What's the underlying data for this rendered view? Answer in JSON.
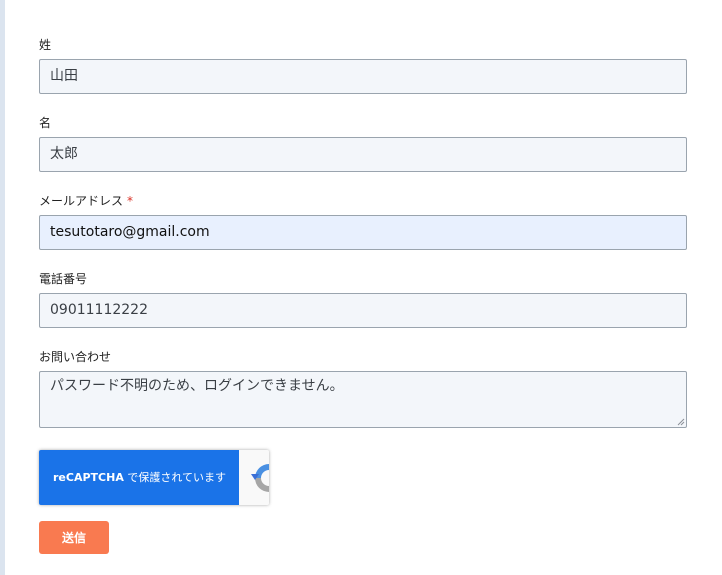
{
  "form": {
    "last_name": {
      "label": "姓",
      "value": "山田"
    },
    "first_name": {
      "label": "名",
      "value": "太郎"
    },
    "email": {
      "label": "メールアドレス",
      "required_mark": "*",
      "value": "tesutotaro@gmail.com"
    },
    "phone": {
      "label": "電話番号",
      "value": "09011112222"
    },
    "inquiry": {
      "label": "お問い合わせ",
      "value": "パスワード不明のため、ログインできません。"
    }
  },
  "captcha": {
    "brand": "reCAPTCHA",
    "text": " で保護されています",
    "accent_color": "#1a73e8"
  },
  "submit": {
    "label": "送信",
    "color": "#f97a50"
  },
  "icons": {
    "captcha_logo": "recaptcha-logo-icon",
    "resize": "resize-grip-icon"
  }
}
